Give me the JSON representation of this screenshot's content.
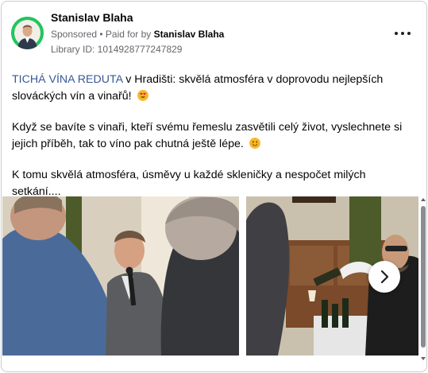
{
  "post": {
    "author": "Stanislav Blaha",
    "sponsored": "Sponsored",
    "paid_by_prefix": " • Paid for by ",
    "paid_by": "Stanislav Blaha",
    "library_id": "Library ID: 1014928777247829",
    "paragraph1": {
      "link": "TICHÁ VÍNA REDUTA",
      "text": " v Hradišti: skvělá atmosféra v doprovodu nejlepších slováckých vín a vinařů! ",
      "emoji": "heart-eyes-emoji"
    },
    "paragraph2": {
      "text": "Když se bavíte s vinaři, kteří svému řemeslu zasvětili celý život, vyslechnete si jejich příběh, tak to víno pak chutná ještě lépe. ",
      "emoji": "smiling-face-emoji"
    },
    "paragraph3": "K tomu skvělá atmosféra, úsměvy u každé skleničky a nespočet milých setkání...."
  },
  "carousel": {
    "slides": [
      "event-photo-speaker-with-microphone",
      "event-photo-wine-pouring"
    ],
    "next_icon": "chevron-right-icon"
  },
  "colors": {
    "avatar_ring": "#22c55e",
    "link": "#385898",
    "secondary_text": "#65676b",
    "border": "#c9ccd1"
  }
}
